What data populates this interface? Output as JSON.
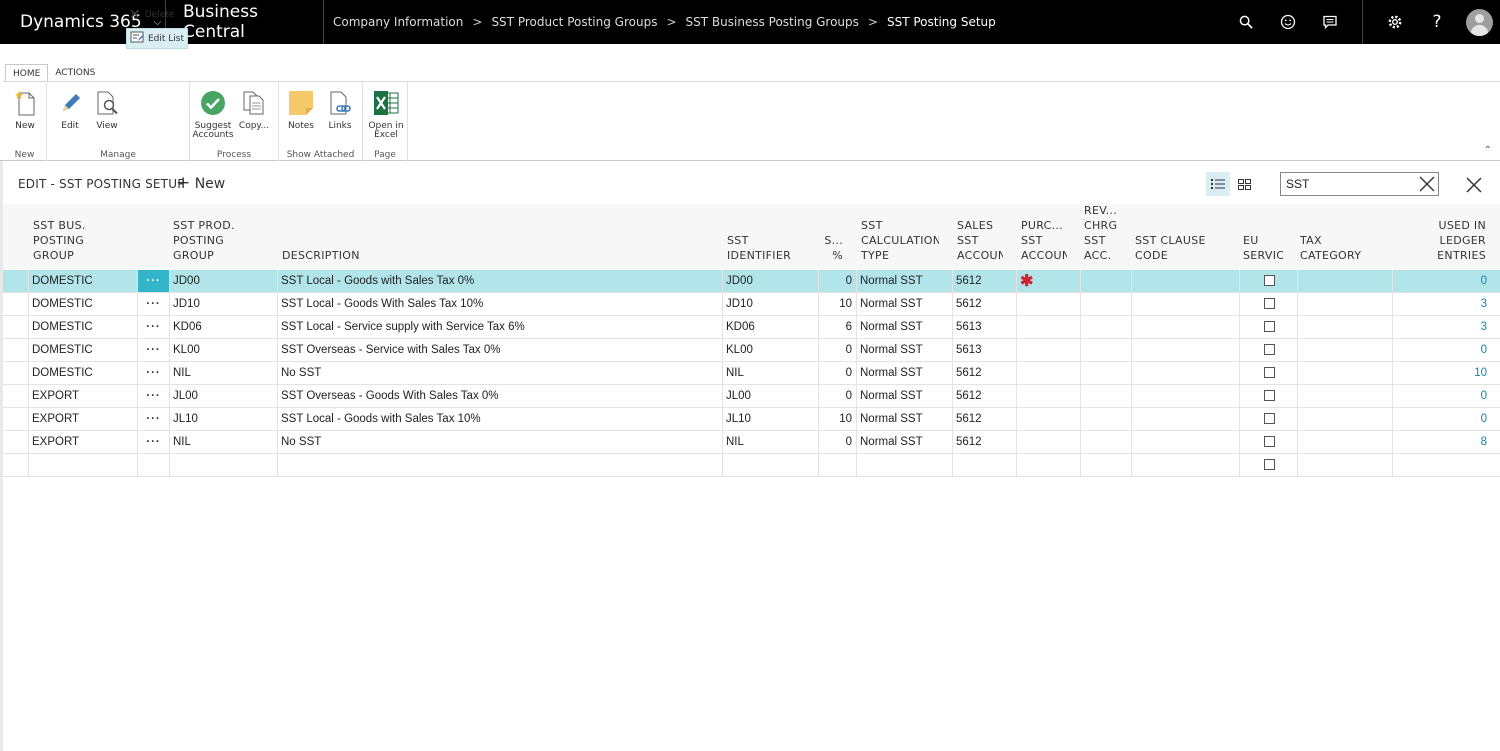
{
  "topbar": {
    "product": "Dynamics 365",
    "app": "Business Central",
    "breadcrumbs": [
      "Company Information",
      "SST Product Posting Groups",
      "SST Business Posting Groups",
      "SST Posting Setup"
    ],
    "icons": [
      "search-icon",
      "smiley-icon",
      "chat-icon",
      "gear-icon",
      "help-icon",
      "user-avatar"
    ]
  },
  "ribbon": {
    "tabs": [
      "HOME",
      "ACTIONS"
    ],
    "new_label": "New",
    "edit_label": "Edit",
    "view_label": "View",
    "delete_label": "Delete",
    "edit_list_label": "Edit List",
    "suggest_label_1": "Suggest",
    "suggest_label_2": "Accounts",
    "copy_label": "Copy...",
    "notes_label": "Notes",
    "links_label": "Links",
    "excel_label_1": "Open in",
    "excel_label_2": "Excel",
    "groups": {
      "new": "New",
      "manage": "Manage",
      "process": "Process",
      "show_attached": "Show Attached",
      "page": "Page"
    }
  },
  "page": {
    "title": "EDIT - SST POSTING SETUP",
    "new_action": "New",
    "search_value": "SST"
  },
  "columns": {
    "bus_group": [
      "SST BUS.",
      "POSTING",
      "GROUP"
    ],
    "prod_group": [
      "SST PROD.",
      "POSTING",
      "GROUP"
    ],
    "description": [
      "DESCRIPTION"
    ],
    "identifier": [
      "SST",
      "IDENTIFIER"
    ],
    "percent": [
      "S...",
      "%"
    ],
    "calc_type": [
      "SST",
      "CALCULATION",
      "TYPE"
    ],
    "sales_acc": [
      "SALES",
      "SST",
      "ACCOUN"
    ],
    "purch_acc": [
      "PURC...",
      "SST",
      "ACCOUN"
    ],
    "rev_chrg": [
      "REV...",
      "CHRG",
      "SST",
      "ACC."
    ],
    "clause": [
      "SST CLAUSE",
      "CODE"
    ],
    "eu_service": [
      "EU",
      "SERVIC"
    ],
    "tax_category": [
      "TAX",
      "CATEGORY"
    ],
    "ledger": [
      "USED IN",
      "LEDGER",
      "ENTRIES"
    ]
  },
  "rows": [
    {
      "bus": "DOMESTIC",
      "prod": "JD00",
      "desc": "SST Local - Goods with Sales Tax 0%",
      "ident": "JD00",
      "pct": "0",
      "calc": "Normal SST",
      "sales": "5612",
      "purch_required": true,
      "entries": "0",
      "selected": true
    },
    {
      "bus": "DOMESTIC",
      "prod": "JD10",
      "desc": "SST Local - Goods With Sales Tax 10%",
      "ident": "JD10",
      "pct": "10",
      "calc": "Normal SST",
      "sales": "5612",
      "purch_required": false,
      "entries": "3",
      "selected": false
    },
    {
      "bus": "DOMESTIC",
      "prod": "KD06",
      "desc": "SST Local - Service supply with Service Tax 6%",
      "ident": "KD06",
      "pct": "6",
      "calc": "Normal SST",
      "sales": "5613",
      "purch_required": false,
      "entries": "3",
      "selected": false
    },
    {
      "bus": "DOMESTIC",
      "prod": "KL00",
      "desc": "SST Overseas - Service with Sales Tax 0%",
      "ident": "KL00",
      "pct": "0",
      "calc": "Normal SST",
      "sales": "5613",
      "purch_required": false,
      "entries": "0",
      "selected": false
    },
    {
      "bus": "DOMESTIC",
      "prod": "NIL",
      "desc": "No SST",
      "ident": "NIL",
      "pct": "0",
      "calc": "Normal SST",
      "sales": "5612",
      "purch_required": false,
      "entries": "10",
      "selected": false
    },
    {
      "bus": "EXPORT",
      "prod": "JL00",
      "desc": "SST Overseas - Goods With Sales Tax 0%",
      "ident": "JL00",
      "pct": "0",
      "calc": "Normal SST",
      "sales": "5612",
      "purch_required": false,
      "entries": "0",
      "selected": false
    },
    {
      "bus": "EXPORT",
      "prod": "JL10",
      "desc": "SST Local - Goods with Sales Tax 10%",
      "ident": "JL10",
      "pct": "10",
      "calc": "Normal SST",
      "sales": "5612",
      "purch_required": false,
      "entries": "0",
      "selected": false
    },
    {
      "bus": "EXPORT",
      "prod": "NIL",
      "desc": "No SST",
      "ident": "NIL",
      "pct": "0",
      "calc": "Normal SST",
      "sales": "5612",
      "purch_required": false,
      "entries": "8",
      "selected": false
    },
    {
      "bus": "",
      "prod": "",
      "desc": "",
      "ident": "",
      "pct": "",
      "calc": "",
      "sales": "",
      "purch_required": false,
      "entries": "",
      "selected": false
    }
  ],
  "colors": {
    "topbar": "#000000",
    "selected_row": "#b2e5ea",
    "accent": "#0a8aa7",
    "required": "#d0232b"
  }
}
